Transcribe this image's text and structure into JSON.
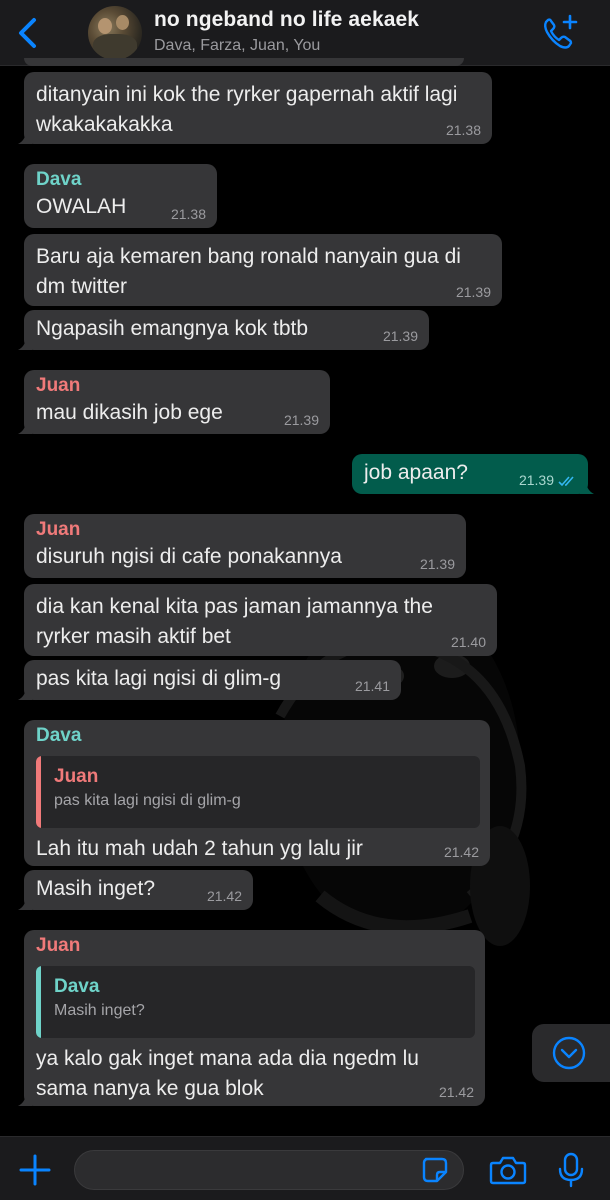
{
  "header": {
    "title": "no ngeband no life aekaek",
    "members": "Dava, Farza, Juan, You",
    "back_icon": "chevron-left-icon",
    "call_icon": "phone-plus-icon"
  },
  "colors": {
    "accent": "#0a84ff",
    "incoming_bubble": "#363638",
    "outgoing_bubble": "#025c4c",
    "dava": "#6fd3c9",
    "juan": "#f07a7a"
  },
  "messages": [
    {
      "text": "ditanyain ini kok the ryrker gapernah aktif lagi wkakakakakka",
      "time": "21.38"
    },
    {
      "sender": "Dava",
      "text": "OWALAH",
      "time": "21.38"
    },
    {
      "text": "Baru aja kemaren bang ronald nanyain gua di dm twitter",
      "time": "21.39"
    },
    {
      "text": "Ngapasih emangnya kok tbtb",
      "time": "21.39"
    },
    {
      "sender": "Juan",
      "text": "mau dikasih job ege",
      "time": "21.39"
    },
    {
      "text": "job apaan?",
      "time": "21.39",
      "status": "read"
    },
    {
      "sender": "Juan",
      "text": "disuruh ngisi di cafe ponakannya",
      "time": "21.39"
    },
    {
      "text": "dia kan kenal kita pas jaman jamannya the ryrker masih aktif bet",
      "time": "21.40"
    },
    {
      "text": "pas kita lagi ngisi di glim-g",
      "time": "21.41"
    },
    {
      "sender": "Dava",
      "quote": {
        "sender": "Juan",
        "text": "pas kita lagi ngisi di glim-g"
      },
      "text": "Lah itu mah udah 2 tahun yg lalu jir",
      "time": "21.42"
    },
    {
      "text": "Masih inget?",
      "time": "21.42"
    },
    {
      "sender": "Juan",
      "quote": {
        "sender": "Dava",
        "text": "Masih inget?"
      },
      "text": "ya kalo gak inget mana ada dia ngedm lu sama nanya ke gua blok",
      "time": "21.42"
    }
  ],
  "composer": {
    "value": "",
    "placeholder": ""
  },
  "icons": {
    "plus": "plus-icon",
    "sticker": "sticker-icon",
    "camera": "camera-icon",
    "mic": "microphone-icon",
    "scroll_down": "chevron-down-circle-icon"
  }
}
